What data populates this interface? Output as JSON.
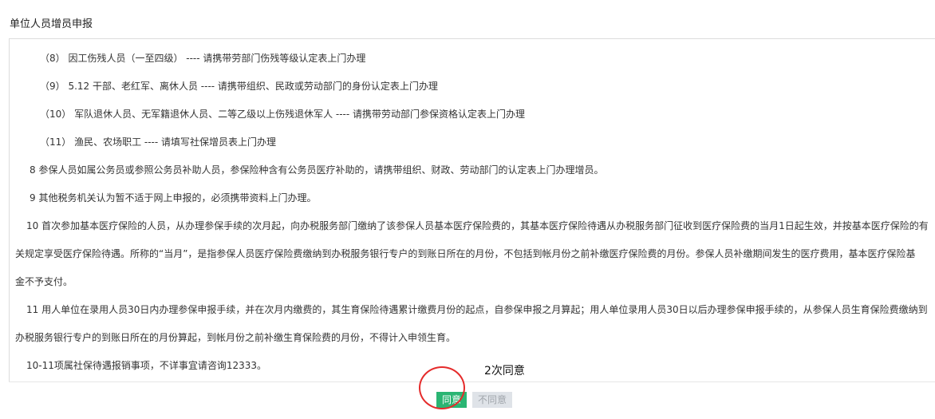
{
  "page": {
    "title": "单位人员增员申报"
  },
  "notice": {
    "lines": [
      "（8） 因工伤残人员（一至四级） ---- 请携带劳部门伤残等级认定表上门办理",
      "（9） 5.12 干部、老红军、离休人员 ---- 请携带组织、民政或劳动部门的身份认定表上门办理",
      "（10） 军队退休人员、无军籍退休人员、二等乙级以上伤残退休军人 ---- 请携带劳动部门参保资格认定表上门办理",
      "（11） 渔民、农场职工 ---- 请填写社保增员表上门办理",
      "8 参保人员如属公务员或参照公务员补助人员，参保险种含有公务员医疗补助的，请携带组织、财政、劳动部门的认定表上门办理增员。",
      "9 其他税务机关认为暂不适于网上申报的，必须携带资料上门办理。",
      "10 首次参加基本医疗保险的人员，从办理参保手续的次月起，向办税服务部门缴纳了该参保人员基本医疗保险费的，其基本医疗保险待遇从办税服务部门征收到医疗保险费的当月1日起生效，并按基本医疗保险的有",
      "关规定享受医疗保险待遇。所称的“当月”，是指参保人员医疗保险费缴纳到办税服务银行专户的到账日所在的月份，不包括到帐月份之前补缴医疗保险费的月份。参保人员补缴期间发生的医疗费用，基本医疗保险基",
      "金不予支付。",
      "11 用人单位在录用人员30日内办理参保申报手续，并在次月内缴费的，其生育保险待遇累计缴费月份的起点，自参保申报之月算起；用人单位录用人员30日以后办理参保申报手续的，从参保人员生育保险费缴纳到",
      "办税服务银行专户的到账日所在的月份算起，到帐月份之前补缴生育保险费的月份，不得计入申领生育。",
      "10-11项属社保待遇报销事项，不详事宜请咨询12333。"
    ]
  },
  "buttons": {
    "agree": "同意",
    "disagree": "不同意"
  },
  "annotation": {
    "text": "2次同意"
  },
  "colors": {
    "agree_bg": "#2ab573",
    "disagree_bg": "#dfe3e8",
    "annotation_circle": "#e52b2b",
    "border": "#dcdcdc"
  }
}
